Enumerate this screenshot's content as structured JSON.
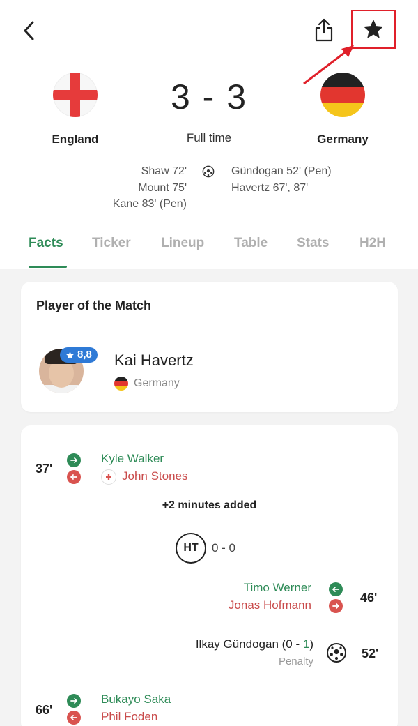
{
  "header": {
    "back_icon": "chevron-left-icon",
    "share_icon": "share-icon",
    "favorite_icon": "star-icon"
  },
  "match": {
    "home": {
      "name": "England",
      "flag": "england-flag"
    },
    "away": {
      "name": "Germany",
      "flag": "germany-flag"
    },
    "score": "3 - 3",
    "status": "Full time",
    "home_scorers": [
      "Shaw 72'",
      "Mount 75'",
      "Kane 83' (Pen)"
    ],
    "away_scorers": [
      "Gündogan 52' (Pen)",
      "Havertz 67', 87'"
    ]
  },
  "tabs": [
    "Facts",
    "Ticker",
    "Lineup",
    "Table",
    "Stats",
    "H2H"
  ],
  "active_tab": "Facts",
  "potm": {
    "title": "Player of the Match",
    "rating": "8,8",
    "player": "Kai Havertz",
    "team": "Germany"
  },
  "events": {
    "sub1": {
      "minute": "37'",
      "in": "Kyle Walker",
      "out": "John Stones"
    },
    "added_time": "+2 minutes added",
    "ht": {
      "label": "HT",
      "score": "0 - 0"
    },
    "sub2": {
      "minute": "46'",
      "in": "Timo Werner",
      "out": "Jonas Hofmann"
    },
    "goal1": {
      "minute": "52'",
      "player": "Ilkay Gündogan (0 - ",
      "score_highlight": "1",
      "close": ")",
      "detail": "Penalty"
    },
    "sub3": {
      "minute": "66'",
      "in": "Bukayo Saka",
      "out": "Phil Foden"
    }
  },
  "colors": {
    "accent": "#2e8b57",
    "sub_out": "#d9534f",
    "rating_badge": "#2f7ad6",
    "annotation": "#e0202a"
  }
}
